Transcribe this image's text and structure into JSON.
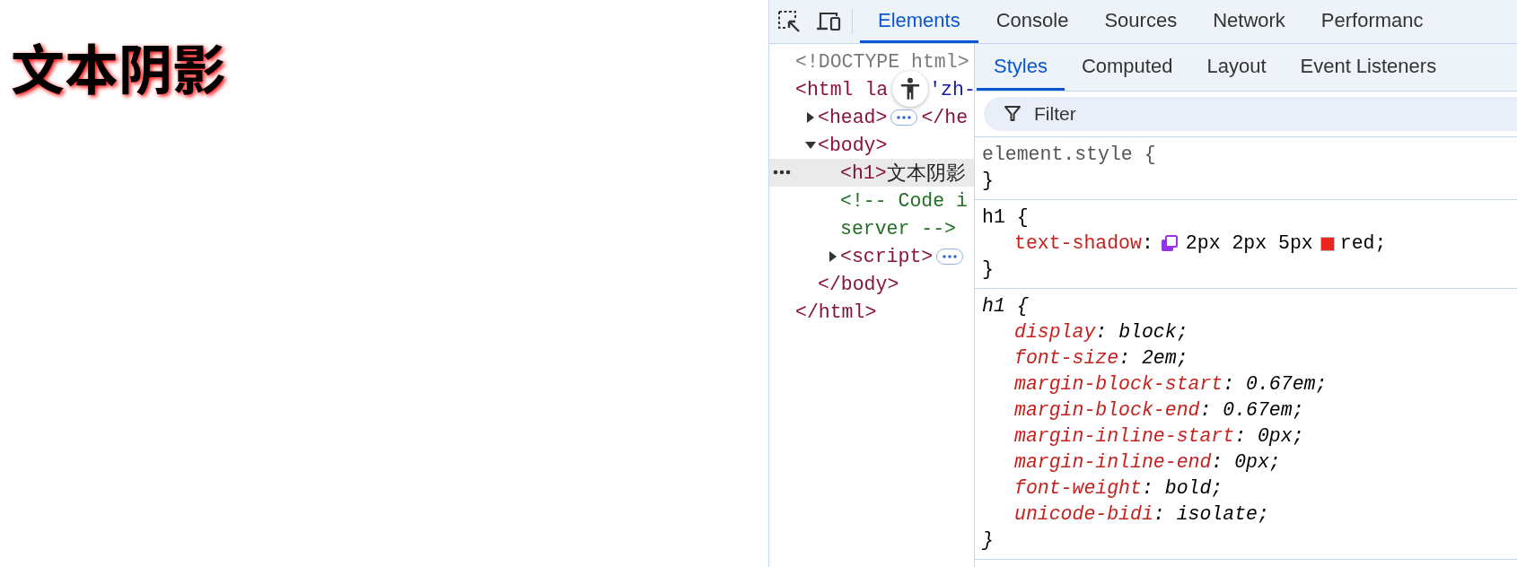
{
  "page": {
    "heading": "文本阴影"
  },
  "devtools": {
    "tabs": [
      {
        "label": "Elements",
        "selected": true
      },
      {
        "label": "Console",
        "selected": false
      },
      {
        "label": "Sources",
        "selected": false
      },
      {
        "label": "Network",
        "selected": false
      },
      {
        "label": "Performanc",
        "selected": false
      }
    ],
    "dom_tree": [
      {
        "kind": "doctype",
        "text": "<!DOCTYPE html>",
        "selected": false
      },
      {
        "kind": "element",
        "open": "<html la",
        "attr": "'zh-",
        "selected": false,
        "close": "</html>",
        "children": [
          {
            "kind": "element",
            "open": "<head>",
            "expanded": false,
            "close": "</he",
            "selected": false
          },
          {
            "kind": "element",
            "open": "<body>",
            "expanded": true,
            "selected": false,
            "close": "</body>",
            "children": [
              {
                "kind": "element",
                "open": "<h1>",
                "content": "文本阴影",
                "selected": true
              },
              {
                "kind": "comment",
                "lines": [
                  "<!-- Code i",
                  "server -->"
                ],
                "selected": false
              },
              {
                "kind": "element",
                "open": "<script>",
                "expanded": false,
                "selected": false
              }
            ]
          }
        ]
      }
    ],
    "sidebar_tabs": [
      {
        "label": "Styles",
        "selected": true
      },
      {
        "label": "Computed",
        "selected": false
      },
      {
        "label": "Layout",
        "selected": false
      },
      {
        "label": "Event Listeners",
        "selected": false
      }
    ],
    "filter": {
      "placeholder": "Filter"
    },
    "rules": [
      {
        "kind": "inline",
        "selector": "element.style {",
        "close": "}"
      },
      {
        "kind": "author",
        "selector": "h1 {",
        "close": "}",
        "declarations": [
          {
            "name": "text-shadow",
            "tokens": [
              {
                "kind": "text",
                "text": ":"
              },
              {
                "kind": "shadow-editor"
              },
              {
                "kind": "text",
                "text": "2px 2px 5px"
              },
              {
                "kind": "swatch",
                "color": "#e8251f"
              },
              {
                "kind": "text",
                "text": "red;"
              }
            ]
          }
        ]
      },
      {
        "kind": "user-agent",
        "selector": "h1 {",
        "close": "}",
        "declarations": [
          {
            "name": "display",
            "tokens": [
              {
                "kind": "text",
                "text": ": block;"
              }
            ]
          },
          {
            "name": "font-size",
            "tokens": [
              {
                "kind": "text",
                "text": ": 2em;"
              }
            ]
          },
          {
            "name": "margin-block-start",
            "tokens": [
              {
                "kind": "text",
                "text": ": 0.67em;"
              }
            ]
          },
          {
            "name": "margin-block-end",
            "tokens": [
              {
                "kind": "text",
                "text": ": 0.67em;"
              }
            ]
          },
          {
            "name": "margin-inline-start",
            "tokens": [
              {
                "kind": "text",
                "text": ": 0px;"
              }
            ]
          },
          {
            "name": "margin-inline-end",
            "tokens": [
              {
                "kind": "text",
                "text": ": 0px;"
              }
            ]
          },
          {
            "name": "font-weight",
            "tokens": [
              {
                "kind": "text",
                "text": ": bold;"
              }
            ]
          },
          {
            "name": "unicode-bidi",
            "tokens": [
              {
                "kind": "text",
                "text": ": isolate;"
              }
            ]
          }
        ]
      }
    ]
  }
}
